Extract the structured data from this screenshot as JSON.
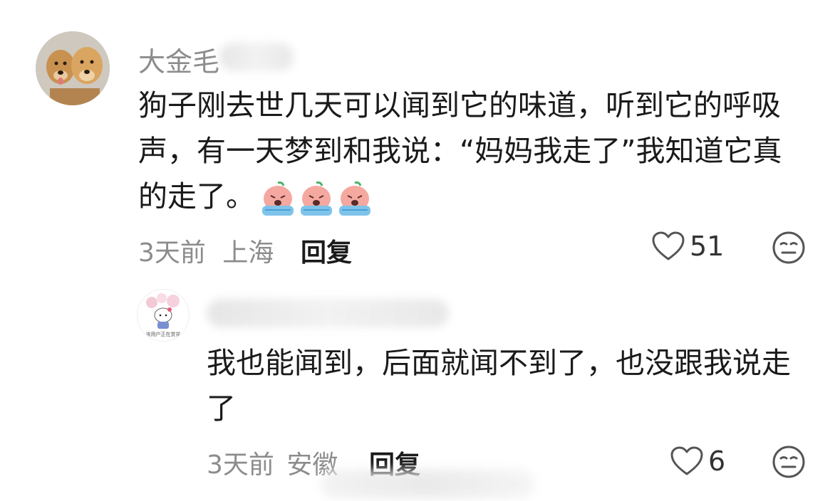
{
  "comments": [
    {
      "username": "大金毛",
      "text": "狗子刚去世几天可以闻到它的味道，听到它的呼吸声，有一天梦到和我说：“妈妈我走了”我知道它真的走了。",
      "time": "3天前",
      "location": "上海",
      "reply_label": "回复",
      "likes": "51",
      "emoji_icon": "crying-peach-emoji"
    },
    {
      "username": "",
      "avatar_caption": "该用户正在赏花",
      "text": "我也能闻到，后面就闻不到了，也没跟我说走了",
      "time": "3天前",
      "location": "安徽",
      "reply_label": "回复",
      "likes": "6"
    }
  ],
  "colors": {
    "text": "#1a1a1a",
    "secondary": "#8c8c8c",
    "background": "#ffffff"
  }
}
